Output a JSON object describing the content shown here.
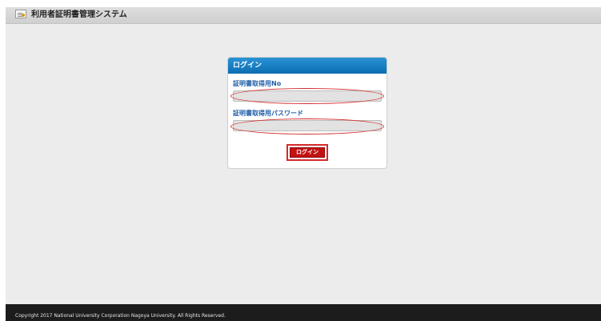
{
  "header": {
    "icon": "certificate-icon",
    "title": "利用者証明書管理システム"
  },
  "login_panel": {
    "title": "ログイン",
    "fields": [
      {
        "label": "証明書取得用No",
        "value": "",
        "placeholder": ""
      },
      {
        "label": "証明書取得用パスワード",
        "value": "",
        "placeholder": ""
      }
    ],
    "login_button": "ログイン",
    "highlight_color": "#d42a2a",
    "header_color": "#0b6db3"
  },
  "footer": {
    "copyright": "Copyright 2017 National University Corporation Nagoya University. All Rights Reserved."
  }
}
